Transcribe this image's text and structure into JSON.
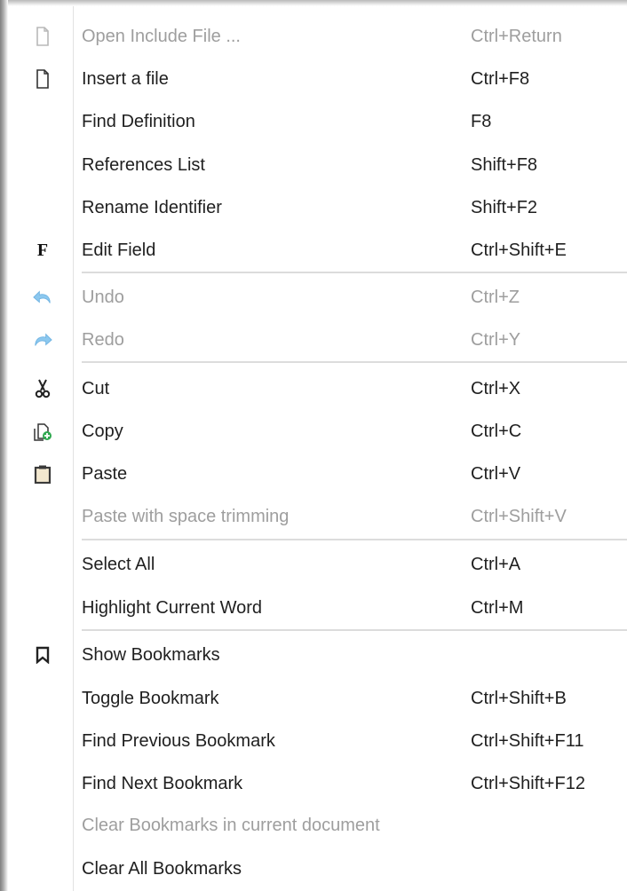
{
  "menu": {
    "items": [
      {
        "label": "Open Include File ...",
        "shortcut": "Ctrl+Return",
        "icon": "file-icon",
        "disabled": true
      },
      {
        "label": "Insert a file",
        "shortcut": "Ctrl+F8",
        "icon": "file-icon",
        "disabled": false
      },
      {
        "label": "Find Definition",
        "shortcut": "F8",
        "icon": "",
        "disabled": false
      },
      {
        "label": "References List",
        "shortcut": "Shift+F8",
        "icon": "",
        "disabled": false
      },
      {
        "label": "Rename Identifier",
        "shortcut": "Shift+F2",
        "icon": "",
        "disabled": false
      },
      {
        "label": "Edit Field",
        "shortcut": "Ctrl+Shift+E",
        "icon": "field-icon",
        "icon_glyph": "F",
        "disabled": false
      },
      {
        "label": "Undo",
        "shortcut": "Ctrl+Z",
        "icon": "undo-icon",
        "disabled": true
      },
      {
        "label": "Redo",
        "shortcut": "Ctrl+Y",
        "icon": "redo-icon",
        "disabled": true
      },
      {
        "label": "Cut",
        "shortcut": "Ctrl+X",
        "icon": "scissors-icon",
        "disabled": false
      },
      {
        "label": "Copy",
        "shortcut": "Ctrl+C",
        "icon": "copy-icon",
        "disabled": false
      },
      {
        "label": "Paste",
        "shortcut": "Ctrl+V",
        "icon": "clipboard-icon",
        "disabled": false
      },
      {
        "label": "Paste with space trimming",
        "shortcut": "Ctrl+Shift+V",
        "icon": "",
        "disabled": true
      },
      {
        "label": "Select All",
        "shortcut": "Ctrl+A",
        "icon": "",
        "disabled": false
      },
      {
        "label": "Highlight Current Word",
        "shortcut": "Ctrl+M",
        "icon": "",
        "disabled": false
      },
      {
        "label": "Show Bookmarks",
        "shortcut": "",
        "icon": "bookmark-icon",
        "disabled": false
      },
      {
        "label": "Toggle Bookmark",
        "shortcut": "Ctrl+Shift+B",
        "icon": "",
        "disabled": false
      },
      {
        "label": "Find Previous Bookmark",
        "shortcut": "Ctrl+Shift+F11",
        "icon": "",
        "disabled": false
      },
      {
        "label": "Find Next Bookmark",
        "shortcut": "Ctrl+Shift+F12",
        "icon": "",
        "disabled": false
      },
      {
        "label": "Clear Bookmarks in current document",
        "shortcut": "",
        "icon": "",
        "disabled": true
      },
      {
        "label": "Clear All Bookmarks",
        "shortcut": "",
        "icon": "",
        "disabled": false
      }
    ]
  },
  "colors": {
    "text": "#1f1f1f",
    "disabled_text": "#9e9e9e",
    "separator": "#dcdcdc",
    "undo_redo_icon": "#8cc8ef",
    "copy_plus": "#2fa84f"
  }
}
